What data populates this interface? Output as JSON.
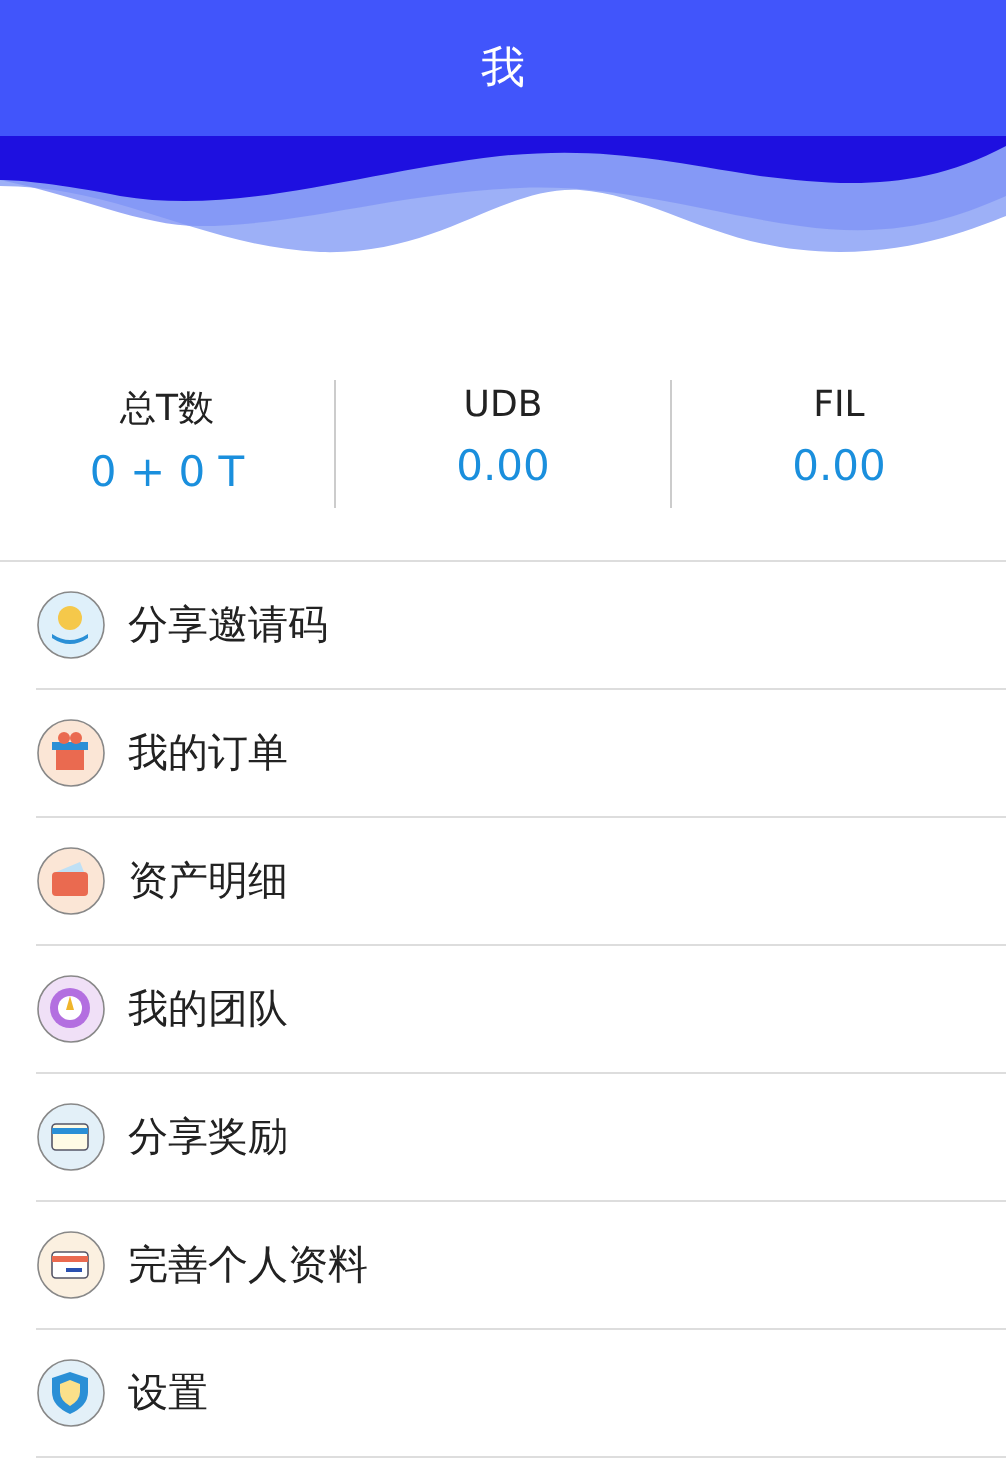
{
  "header": {
    "title": "我"
  },
  "stats": [
    {
      "label": "总T数",
      "value": "0 + 0 T"
    },
    {
      "label": "UDB",
      "value": "0.00"
    },
    {
      "label": "FIL",
      "value": "0.00"
    }
  ],
  "menu": [
    {
      "label": "分享邀请码",
      "kind": "coin"
    },
    {
      "label": "我的订单",
      "kind": "gift"
    },
    {
      "label": "资产明细",
      "kind": "wallet"
    },
    {
      "label": "我的团队",
      "kind": "target"
    },
    {
      "label": "分享奖励",
      "kind": "card"
    },
    {
      "label": "完善个人资料",
      "kind": "idcard"
    },
    {
      "label": "设置",
      "kind": "shield"
    }
  ]
}
